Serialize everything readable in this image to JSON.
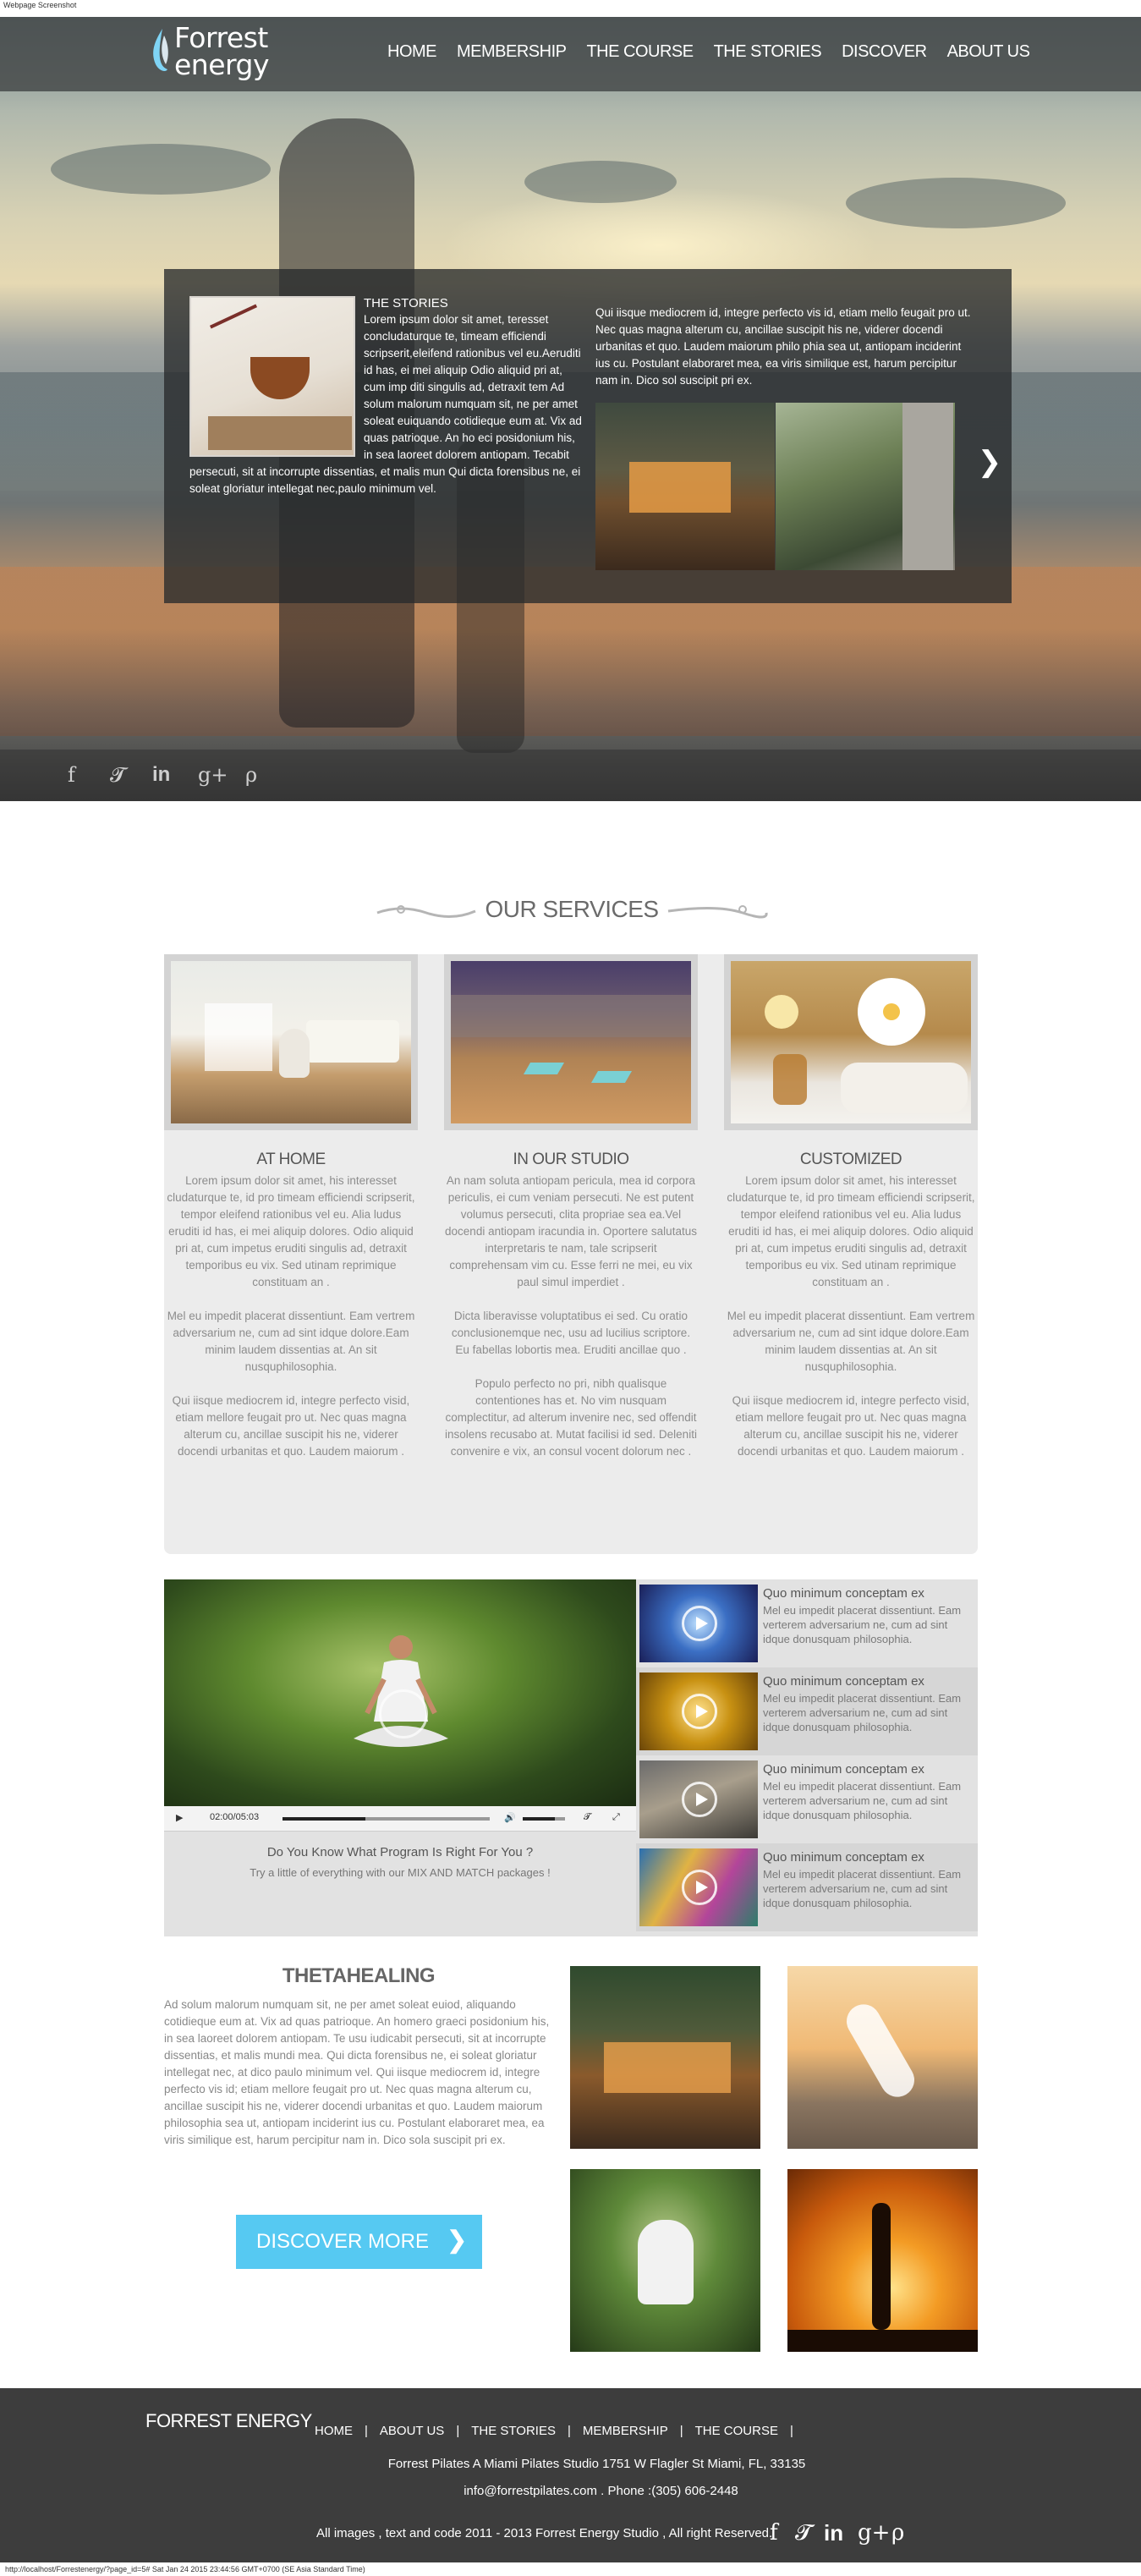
{
  "screenshot_caption": "Webpage Screenshot",
  "logo": {
    "line1": "Forrest",
    "line2": "energy"
  },
  "nav": [
    "HOME",
    "MEMBERSHIP",
    "THE COURSE",
    "THE STORIES",
    "DISCOVER",
    "ABOUT US"
  ],
  "stories": {
    "heading": "THE STORIES",
    "left_text": "Lorem ipsum dolor sit amet, teresset concludaturque te, timeam efficiendi scripserit,eleifend rationibus vel eu.Aeruditi id has, ei mei aliquip Odio aliquid pri at, cum imp diti singulis ad, detraxit tem Ad solum malorum numquam sit, ne per amet soleat euiquando cotidieque eum at. Vix ad quas patrioque. An ho eci posidonium his, in sea laoreet dolorem antiopam. Tecabit persecuti, sit at incorrupte dissentias, et malis mun Qui dicta forensibus ne, ei soleat gloriatur intellegat nec,paulo minimum vel.",
    "right_text": "Qui iisque mediocrem id, integre perfecto vis id, etiam mello feugait pro ut. Nec quas magna alterum cu, ancillae suscipit his ne, viderer docendi urbanitas et quo. Laudem maiorum philo phia sea ut, antiopam inciderint ius cu. Postulant elaboraret mea, ea viris similique est, harum percipitur nam in. Dico sol suscipit pri ex.",
    "next_icon": "chevron-right-icon"
  },
  "social_icons": [
    "facebook-icon",
    "twitter-icon",
    "linkedin-icon",
    "google-plus-icon",
    "pinterest-icon"
  ],
  "services": {
    "title": "OUR SERVICES",
    "items": [
      {
        "title": "AT HOME",
        "paragraphs": [
          "Lorem ipsum dolor sit amet, his interesset cludaturque te, id pro timeam efficiendi scripserit, tempor eleifend rationibus vel eu. Alia ludus eruditi id has, ei mei aliquip dolores. Odio aliquid pri at, cum impetus eruditi singulis ad, detraxit temporibus eu vix. Sed utinam reprimique constituam an .",
          "Mel eu impedit placerat dissentiunt. Eam vertrem adversarium ne, cum ad sint idque dolore.Eam minim laudem dissentias at. An sit nusquphilosophia.",
          "Qui iisque mediocrem id, integre perfecto visid, etiam mellore feugait pro ut. Nec quas magna alterum cu, ancillae suscipit his ne, viderer docendi urbanitas et quo. Laudem maiorum ."
        ]
      },
      {
        "title": "IN OUR STUDIO",
        "paragraphs": [
          "An nam soluta antiopam pericula, mea id corpora periculis, ei cum veniam persecuti. Ne est putent volumus persecuti, clita propriae sea ea.Vel docendi antiopam iracundia in. Oportere salutatus interpretaris te nam, tale scripserit comprehensam vim cu. Esse ferri ne mei, eu vix paul simul imperdiet .",
          "Dicta liberavisse voluptatibus ei sed. Cu oratio conclusionemque nec, usu ad lucilius scriptore. Eu fabellas lobortis mea. Eruditi ancillae quo .",
          "Populo perfecto no pri, nibh qualisque contentiones has et. No vim nusquam complectitur, ad alterum invenire nec, sed offendit insolens recusabo at. Mutat facilisi id sed. Deleniti convenire e vix, an consul vocent dolorum nec ."
        ]
      },
      {
        "title": "CUSTOMIZED",
        "paragraphs": [
          "Lorem ipsum dolor sit amet, his interesset cludaturque te, id pro timeam efficiendi scripserit, tempor eleifend rationibus vel eu. Alia ludus eruditi id has, ei mei aliquip dolores. Odio aliquid pri at, cum impetus eruditi singulis ad, detraxit temporibus eu vix. Sed utinam reprimique constituam an .",
          "Mel eu impedit placerat dissentiunt. Eam vertrem adversarium ne, cum ad sint idque dolore.Eam minim laudem dissentias at. An sit nusquphilosophia.",
          "Qui iisque mediocrem id, integre perfecto visid, etiam mellore feugait pro ut. Nec quas magna alterum cu, ancillae suscipit his ne, viderer docendi urbanitas et quo. Laudem maiorum ."
        ]
      }
    ]
  },
  "video": {
    "time": "02:00/05:03",
    "progress": 0.4,
    "volume": 0.75,
    "question": "Do You Know What Program Is Right For You ?",
    "subtext": "Try a little of everything with our MIX AND MATCH packages !"
  },
  "playlist": [
    {
      "title": "Quo minimum conceptam ex",
      "desc": "Mel eu impedit placerat dissentiunt. Eam verterem adversarium ne, cum ad sint idque donusquam philosophia."
    },
    {
      "title": "Quo minimum conceptam ex",
      "desc": "Mel eu impedit placerat dissentiunt. Eam verterem adversarium ne, cum ad sint idque donusquam philosophia."
    },
    {
      "title": "Quo minimum conceptam ex",
      "desc": "Mel eu impedit placerat dissentiunt. Eam verterem adversarium ne, cum ad sint idque donusquam philosophia."
    },
    {
      "title": "Quo minimum conceptam ex",
      "desc": "Mel eu impedit placerat dissentiunt. Eam verterem adversarium ne, cum ad sint idque donusquam philosophia."
    }
  ],
  "theta": {
    "title": "THETAHEALING",
    "body": "Ad solum malorum numquam sit, ne per amet soleat euiod, aliquando cotidieque eum at. Vix ad quas patrioque. An homero graeci posidonium his, in sea laoreet dolorem antiopam. Te usu iudicabit persecuti, sit at incorrupte dissentias, et malis mundi mea. Qui dicta forensibus ne, ei soleat gloriatur intellegat nec, at dico paulo minimum vel. Qui iisque mediocrem id, integre perfecto vis id; etiam mellore feugait pro ut. Nec quas magna alterum cu, ancillae suscipit his ne, viderer docendi urbanitas et quo. Laudem maiorum philosophia sea ut, antiopam inciderint ius cu. Postulant elaboraret mea, ea viris similique est, harum percipitur nam in. Dico sola suscipit pri ex.",
    "button": "DISCOVER MORE"
  },
  "footer": {
    "brand": "FORREST ENERGY",
    "nav": [
      "HOME",
      "ABOUT US",
      "THE STORIES",
      "MEMBERSHIP",
      "THE COURSE"
    ],
    "address": "Forrest Pilates A Miami Pilates Studio 1751 W Flagler St Miami, FL, 33135",
    "contact": "info@forrestpilates.com . Phone :(305) 606-2448",
    "copyright": "All images , text and code 2011 - 2013 Forrest Energy Studio , All right Reserved."
  },
  "status_url": "http://localhost/Forrestenergy/?page_id=5# Sat Jan 24 2015 23:44:56 GMT+0700 (SE Asia Standard Time)",
  "colors": {
    "accent": "#56c9f2",
    "footer_bg": "#3d3d3d",
    "nav_bg": "#464a4a"
  }
}
